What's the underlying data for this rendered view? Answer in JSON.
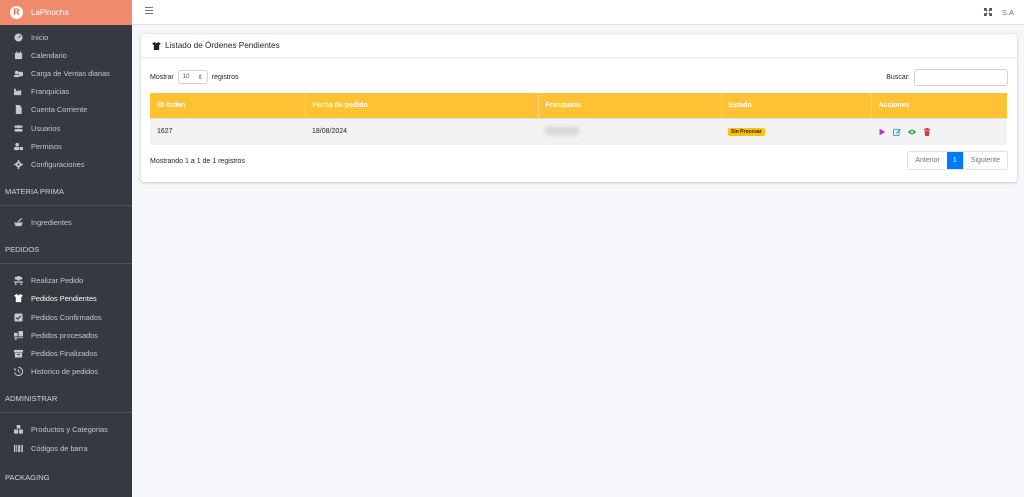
{
  "brand": {
    "name": "LaPinocha",
    "logo_letter": "R"
  },
  "sidebar": {
    "main_items": [
      {
        "label": "Inicio",
        "icon": "dashboard-icon"
      },
      {
        "label": "Calendario",
        "icon": "calendar-icon"
      },
      {
        "label": "Carga de Ventas diarias",
        "icon": "sales-icon"
      },
      {
        "label": "Franquicias",
        "icon": "industry-icon"
      },
      {
        "label": "Cuenta Corriente",
        "icon": "file-icon"
      },
      {
        "label": "Usuarios",
        "icon": "users-icon"
      },
      {
        "label": "Permisos",
        "icon": "user-lock-icon"
      },
      {
        "label": "Configuraciones",
        "icon": "gear-icon"
      }
    ],
    "sections": {
      "materia_prima": "MATERIA PRIMA",
      "pedidos": "PEDIDOS",
      "administrar": "ADMINISTRAR",
      "packaging": "PACKAGING"
    },
    "materia_items": [
      {
        "label": "Ingredientes",
        "icon": "mortar-icon"
      }
    ],
    "pedidos_items": [
      {
        "label": "Realizar Pedido",
        "icon": "dolly-icon"
      },
      {
        "label": "Pedidos Pendientes",
        "icon": "box-open-icon",
        "active": true
      },
      {
        "label": "Pedidos Confirmados",
        "icon": "check-square-icon"
      },
      {
        "label": "Pedidos procesados",
        "icon": "truck-loading-icon"
      },
      {
        "label": "Pedidos Finalizados",
        "icon": "archive-icon"
      },
      {
        "label": "Historico de pedidos",
        "icon": "history-icon"
      }
    ],
    "admin_items": [
      {
        "label": "Productos y Categorias",
        "icon": "boxes-icon"
      },
      {
        "label": "Códigos de barra",
        "icon": "barcode-icon"
      }
    ]
  },
  "topbar": {
    "user": "S.A"
  },
  "card": {
    "title": "Listado de Órdenes Pendientes",
    "show_label": "Mostrar",
    "page_size": "10",
    "records_label": "registros",
    "search_label": "Buscar:",
    "search_value": "",
    "columns": [
      "ID órden",
      "Fecha de pedido",
      "Franquicia",
      "Estado",
      "Acciones"
    ],
    "rows": [
      {
        "id": "1627",
        "date": "18/08/2024",
        "franchise": "",
        "status": "Sin Procesar"
      }
    ],
    "info": "Mostrando 1 a 1 de 1 registros",
    "pager": {
      "prev": "Anterior",
      "current": "1",
      "next": "Siguiente"
    }
  },
  "colors": {
    "accent": "#ffc233",
    "brand": "#f08a6c",
    "sidebar": "#343a40",
    "primary": "#007bff",
    "badge": "#ffc107"
  }
}
